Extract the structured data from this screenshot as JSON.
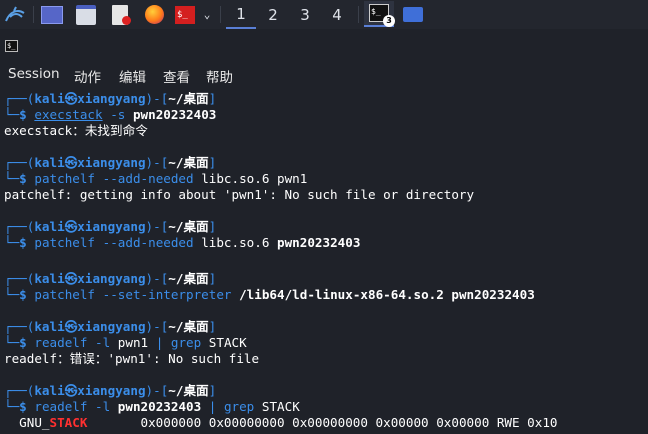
{
  "taskbar": {
    "workspaces": [
      "1",
      "2",
      "3",
      "4"
    ],
    "active_workspace": "1",
    "terminal_task_badge": "3"
  },
  "window": {
    "menu": [
      "Session",
      "动作",
      "编辑",
      "查看",
      "帮助"
    ]
  },
  "prompt": {
    "top_prefix": "┌──(",
    "user": "kali",
    "at": "㉿",
    "host": "xiangyang",
    "mid": ")-[",
    "path": "~/桌面",
    "close": "]",
    "bottom_prefix": "└─",
    "dollar": "$"
  },
  "entries": [
    {
      "cmd": "execstack",
      "args": [
        {
          "t": " -s ",
          "c": "cmdblue"
        },
        {
          "t": "pwn20232403",
          "c": "wb"
        }
      ],
      "output": "execstack：未找到命令"
    },
    {
      "cmd": "patchelf",
      "args": [
        {
          "t": " --add-needed ",
          "c": "cmdblue"
        },
        {
          "t": "libc.so.6 pwn1",
          "c": "white"
        }
      ],
      "output": "patchelf: getting info about 'pwn1': No such file or directory"
    },
    {
      "cmd": "patchelf",
      "args": [
        {
          "t": " --add-needed ",
          "c": "cmdblue"
        },
        {
          "t": "libc.so.6 ",
          "c": "white"
        },
        {
          "t": "pwn20232403",
          "c": "wb"
        }
      ],
      "output": ""
    },
    {
      "cmd": "patchelf",
      "args": [
        {
          "t": " --set-interpreter ",
          "c": "cmdblue"
        },
        {
          "t": "/lib64/ld-linux-x86-64.so.2 pwn20232403",
          "c": "wb"
        }
      ],
      "output": ""
    },
    {
      "cmd": "readelf",
      "args": [
        {
          "t": " -l ",
          "c": "cmdblue"
        },
        {
          "t": "pwn1 ",
          "c": "white"
        },
        {
          "t": "| ",
          "c": "cmdblue"
        },
        {
          "t": "grep",
          "c": "cmdblue"
        },
        {
          "t": " STACK",
          "c": "white"
        }
      ],
      "output": "readelf：错误：'pwn1': No such file"
    },
    {
      "cmd": "readelf",
      "args": [
        {
          "t": " -l ",
          "c": "cmdblue"
        },
        {
          "t": "pwn20232403",
          "c": "wb"
        },
        {
          "t": " | ",
          "c": "cmdblue"
        },
        {
          "t": "grep",
          "c": "cmdblue"
        },
        {
          "t": " STACK",
          "c": "white"
        }
      ],
      "output": ""
    }
  ],
  "last_output": {
    "prefix": "  GNU_",
    "highlight": "STACK",
    "rest": "       0x000000 0x00000000 0x00000000 0x00000 0x00000 RWE 0x10"
  }
}
